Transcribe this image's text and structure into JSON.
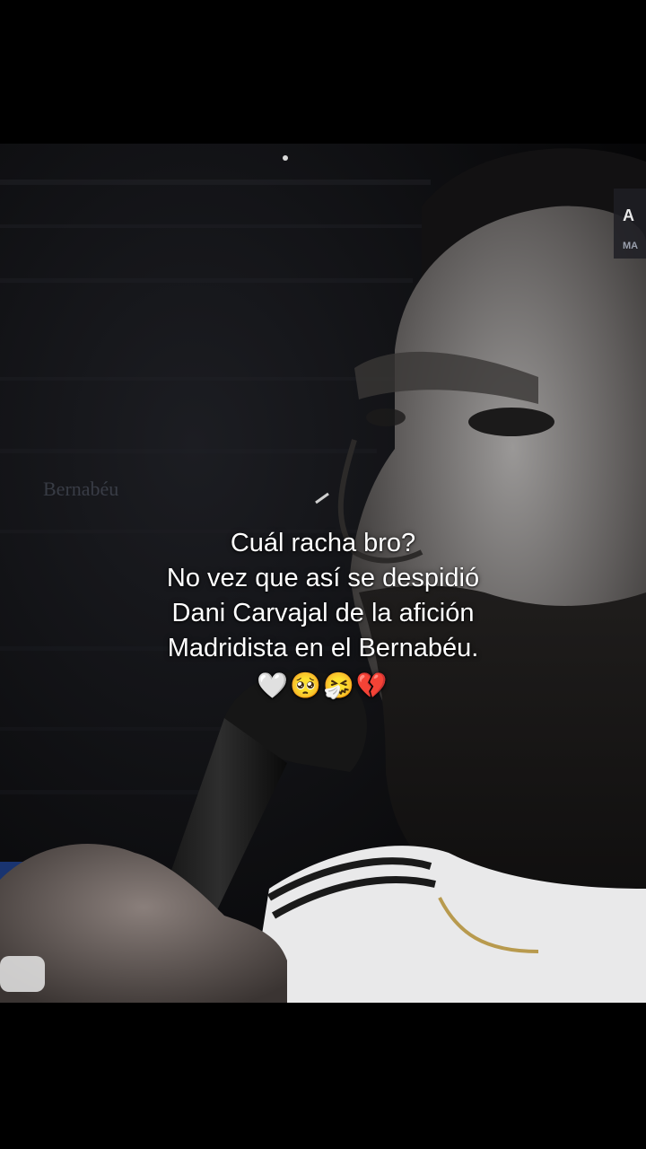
{
  "video": {
    "stadium_sign": "Bernabéu",
    "overlay_badge": {
      "line1": "A",
      "line2": "MA"
    }
  },
  "caption": {
    "lines": [
      "Cuál racha bro?",
      "No vez que así se despidió",
      "Dani Carvajal de la afición",
      "Madridista en el Bernabéu."
    ],
    "emojis": "🤍🥺🤧💔"
  },
  "colors": {
    "background": "#000000",
    "caption_text": "#ffffff",
    "jersey": "#e9e9ea",
    "jersey_stripe": "#1a1a1a",
    "jersey_trim_gold": "#b89a4e"
  }
}
